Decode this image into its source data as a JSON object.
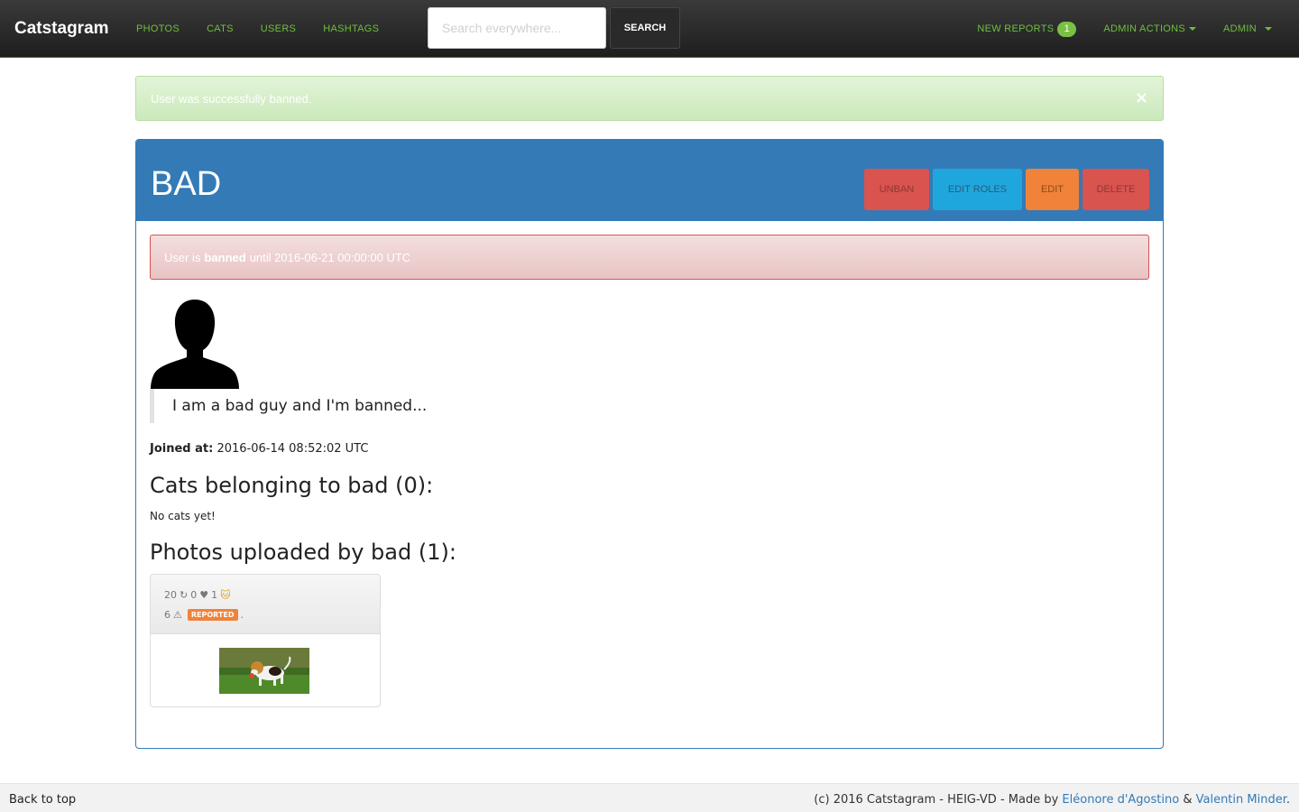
{
  "navbar": {
    "brand": "Catstagram",
    "links": [
      "PHOTOS",
      "CATS",
      "USERS",
      "HASHTAGS"
    ],
    "search_placeholder": "Search everywhere...",
    "search_button": "SEARCH",
    "new_reports_label": "NEW REPORTS",
    "new_reports_count": "1",
    "admin_actions_label": "ADMIN ACTIONS",
    "admin_label": "ADMIN"
  },
  "flash": {
    "message": "User was successfully banned.",
    "close": "×"
  },
  "user": {
    "name": "BAD",
    "ban_prefix": "User is",
    "ban_word": "banned",
    "ban_suffix": "until 2016-06-21 00:00:00 UTC",
    "bio": "I am a bad guy and I'm banned...",
    "joined_label": "Joined at:",
    "joined_value": "2016-06-14 08:52:02 UTC"
  },
  "actions": {
    "unban": "UNBAN",
    "edit_roles": "EDIT ROLES",
    "edit": "EDIT",
    "delete": "DELETE"
  },
  "cats_section": {
    "heading": "Cats belonging to bad (0):",
    "empty": "No cats yet!"
  },
  "photos_section": {
    "heading": "Photos uploaded by bad (1):",
    "photo": {
      "views": "20",
      "repost_icon": "↻",
      "reposts": "0",
      "like_icon": "♥",
      "likes": "1",
      "cat_icon": "🐱",
      "reports": "6",
      "warning_icon": "⚠",
      "reported_label": "REPORTED",
      "trailing_dot": "."
    }
  },
  "footer": {
    "back_to_top": "Back to top",
    "credits_prefix": "(c) 2016 Catstagram - HEIG-VD - Made by",
    "author1": "Eléonore d'Agostino",
    "amp": "&",
    "author2": "Valentin Minder",
    "trailing_dot": "."
  }
}
